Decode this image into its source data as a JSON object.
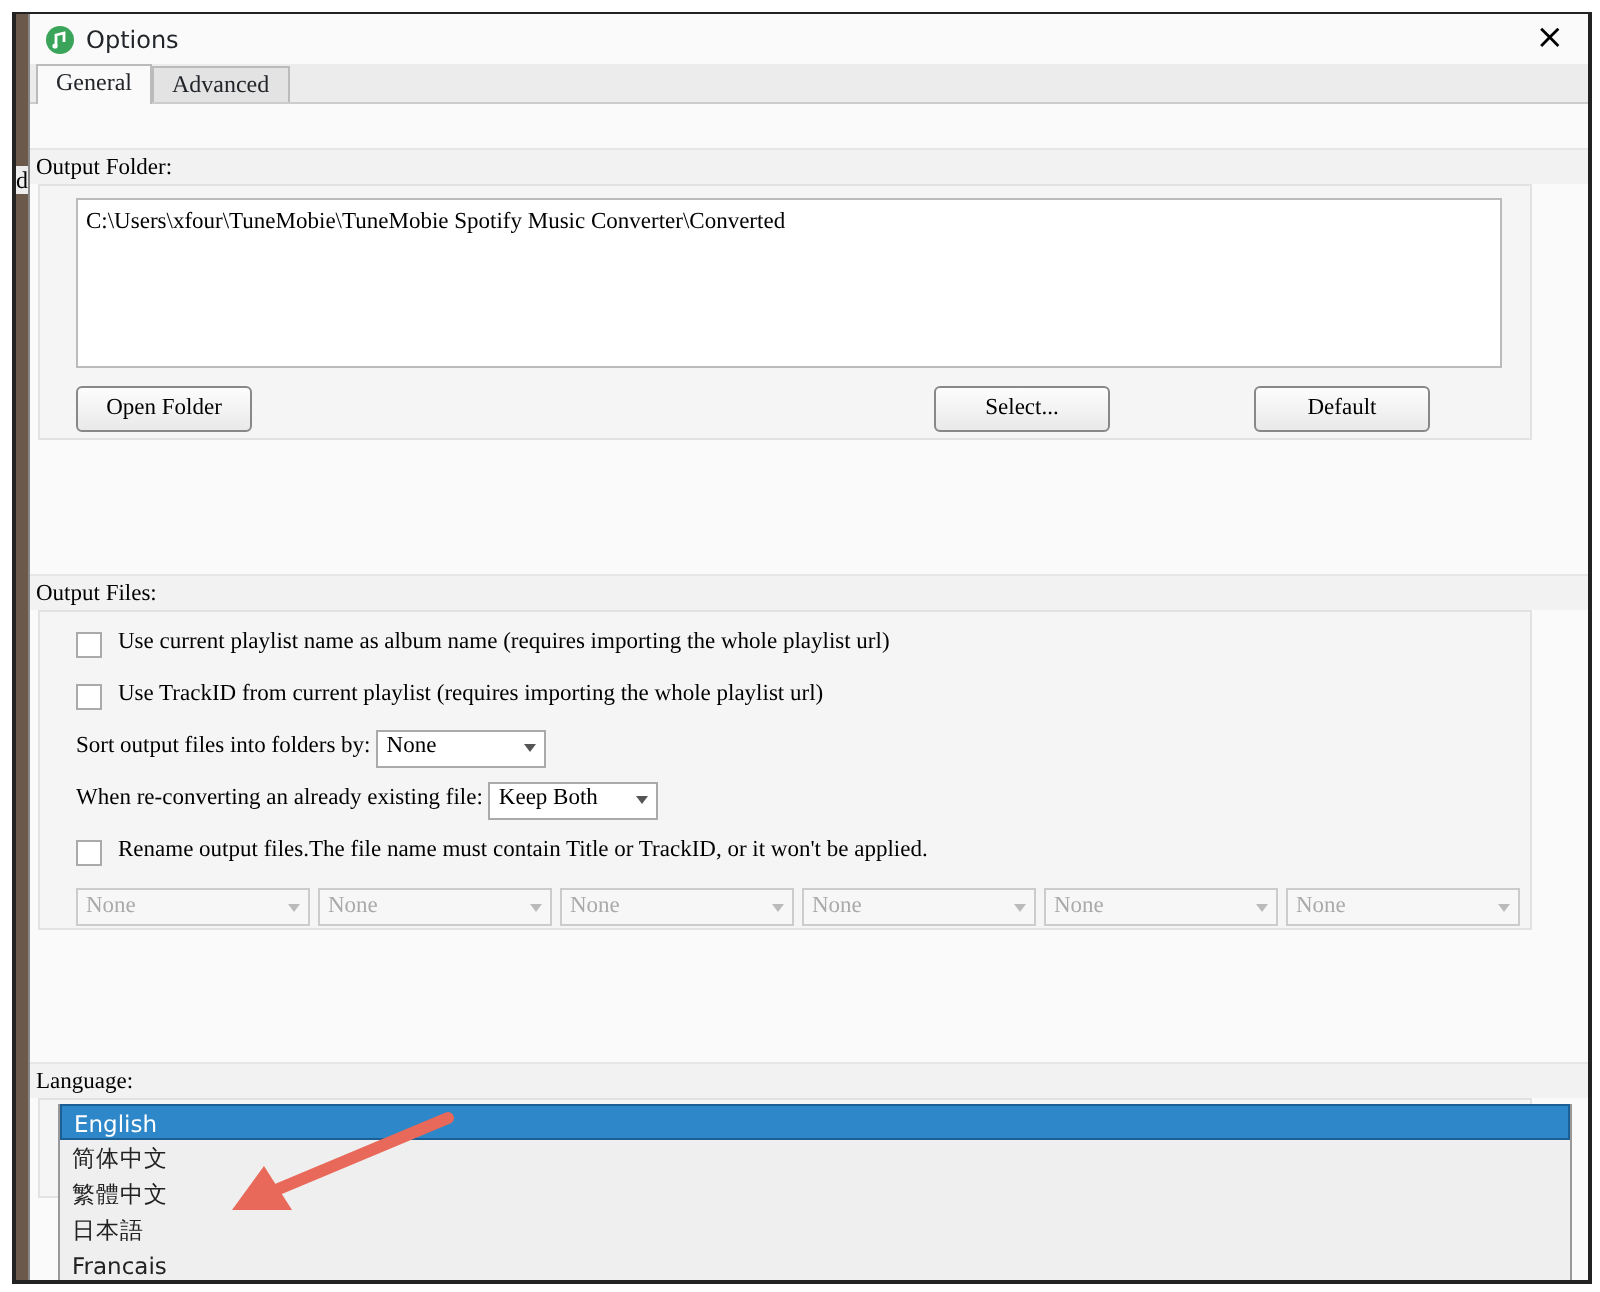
{
  "background_window": {
    "text": "d"
  },
  "window": {
    "title": "Options",
    "close": "×"
  },
  "tabs": [
    {
      "label": "General",
      "selected": true
    },
    {
      "label": "Advanced",
      "selected": false
    }
  ],
  "output_folder": {
    "label": "Output Folder:",
    "path": "C:\\Users\\xfour\\TuneMobie\\TuneMobie Spotify Music Converter\\Converted",
    "buttons": [
      "Open Folder",
      "Select...",
      "Default"
    ]
  },
  "output_files": {
    "label": "Output Files:",
    "options": [
      {
        "kind": "checkbox",
        "label": "Use current playlist name as album name (requires importing the whole playlist url)",
        "checked": false
      },
      {
        "kind": "checkbox",
        "label": "Use TrackID from current playlist (requires importing the whole playlist url)",
        "checked": false
      },
      {
        "kind": "select",
        "label": "Sort output files into folders by:",
        "value": "None"
      },
      {
        "kind": "select",
        "label": "When re-converting an already existing file:",
        "value": "Keep Both"
      },
      {
        "kind": "checkbox",
        "label": "Rename output files.The file name must contain Title or TrackID, or it won't be applied.",
        "checked": false
      }
    ],
    "rename_fields": [
      {
        "value": "None",
        "disabled": true
      },
      {
        "value": "None",
        "disabled": true
      },
      {
        "value": "None",
        "disabled": true
      },
      {
        "value": "None",
        "disabled": true
      },
      {
        "value": "None",
        "disabled": true
      },
      {
        "value": "None",
        "disabled": true
      }
    ]
  },
  "language": {
    "label": "Language:",
    "options": [
      {
        "label": "English",
        "selected": true
      },
      {
        "label": "简体中文",
        "selected": false
      },
      {
        "label": "繁體中文",
        "selected": false
      },
      {
        "label": "日本語",
        "selected": false
      },
      {
        "label": "Francais",
        "selected": false
      }
    ]
  },
  "annotation": {
    "kind": "arrow",
    "color": "#e8685a"
  }
}
